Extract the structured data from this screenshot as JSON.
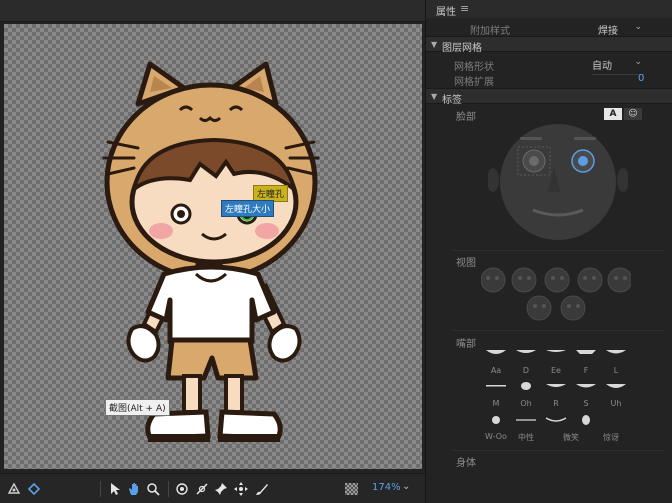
{
  "stage": {
    "tag_yellow": "左瞳孔",
    "tag_blue": "左瞳孔大小",
    "tooltip": "截图(Alt + A)"
  },
  "toolbar": {
    "zoom": "174%",
    "icons": [
      "puppet-pin-icon",
      "warp-icon",
      "select-arrow-icon",
      "hand-icon",
      "zoom-icon",
      "origin-icon",
      "pin-icon",
      "stick-icon",
      "dragger-icon",
      "draw-icon"
    ]
  },
  "panel": {
    "title": "属性",
    "additional_style_label": "附加样式",
    "additional_style_value": "焊接",
    "mesh_section": "图层网格",
    "mesh_shape_label": "网格形状",
    "mesh_shape_value": "自动",
    "mesh_expand_label": "网格扩展",
    "mesh_expand_value": "0",
    "tags_section": "标签",
    "face_label": "脸部",
    "toggle_a": "A",
    "toggle_b": "☺",
    "view_label": "视图",
    "mouth_label": "嘴部",
    "mouth_row1": [
      "Aa",
      "D",
      "Ee",
      "F",
      "L"
    ],
    "mouth_row2": [
      "M",
      "Oh",
      "R",
      "S",
      "Uh"
    ],
    "mouth_row3": [
      "W-Oo",
      "中性",
      "微笑",
      "惊讶"
    ],
    "body_label": "身体"
  },
  "colors": {
    "accent_blue": "#5aa0e6",
    "tag_yellow": "#c9b21b",
    "tag_blue": "#2f7bbf"
  }
}
